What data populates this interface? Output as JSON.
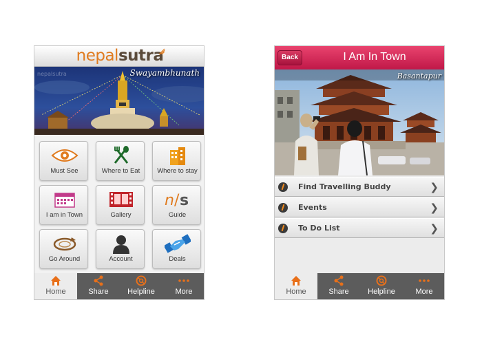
{
  "left_app": {
    "logo": {
      "part1": "nepal",
      "part2": "sutra"
    },
    "banner": {
      "caption": "Swayambhunath",
      "watermark": "nepalsutra"
    },
    "tiles": [
      {
        "label": "Must See",
        "icon": "eye-icon"
      },
      {
        "label": "Where to Eat",
        "icon": "fork-spoon-icon"
      },
      {
        "label": "Where to stay",
        "icon": "building-icon"
      },
      {
        "label": "I am in Town",
        "icon": "calendar-icon"
      },
      {
        "label": "Gallery",
        "icon": "film-strip-icon"
      },
      {
        "label": "Guide",
        "icon": "ns-logo-icon"
      },
      {
        "label": "Go Around",
        "icon": "orbit-icon"
      },
      {
        "label": "Account",
        "icon": "person-icon"
      },
      {
        "label": "Deals",
        "icon": "handshake-icon"
      }
    ],
    "tabs": [
      {
        "label": "Home",
        "icon": "home-icon",
        "active": true
      },
      {
        "label": "Share",
        "icon": "share-icon",
        "active": false
      },
      {
        "label": "Helpline",
        "icon": "lifebuoy-icon",
        "active": false
      },
      {
        "label": "More",
        "icon": "more-dots-icon",
        "active": false
      }
    ]
  },
  "right_app": {
    "back_label": "Back",
    "title": "I Am In Town",
    "photo_caption": "Basantapur",
    "list": [
      {
        "label": "Find Travelling Buddy"
      },
      {
        "label": "Events"
      },
      {
        "label": "To Do List"
      }
    ],
    "tabs": [
      {
        "label": "Home",
        "icon": "home-icon",
        "active": true
      },
      {
        "label": "Share",
        "icon": "share-icon",
        "active": false
      },
      {
        "label": "Helpline",
        "icon": "lifebuoy-icon",
        "active": false
      },
      {
        "label": "More",
        "icon": "more-dots-icon",
        "active": false
      }
    ]
  },
  "colors": {
    "brand_orange": "#e07b1f",
    "header_pink": "#c01848",
    "tabbar_gray": "#5c5c5c",
    "tab_icon_orange": "#e8701a"
  }
}
